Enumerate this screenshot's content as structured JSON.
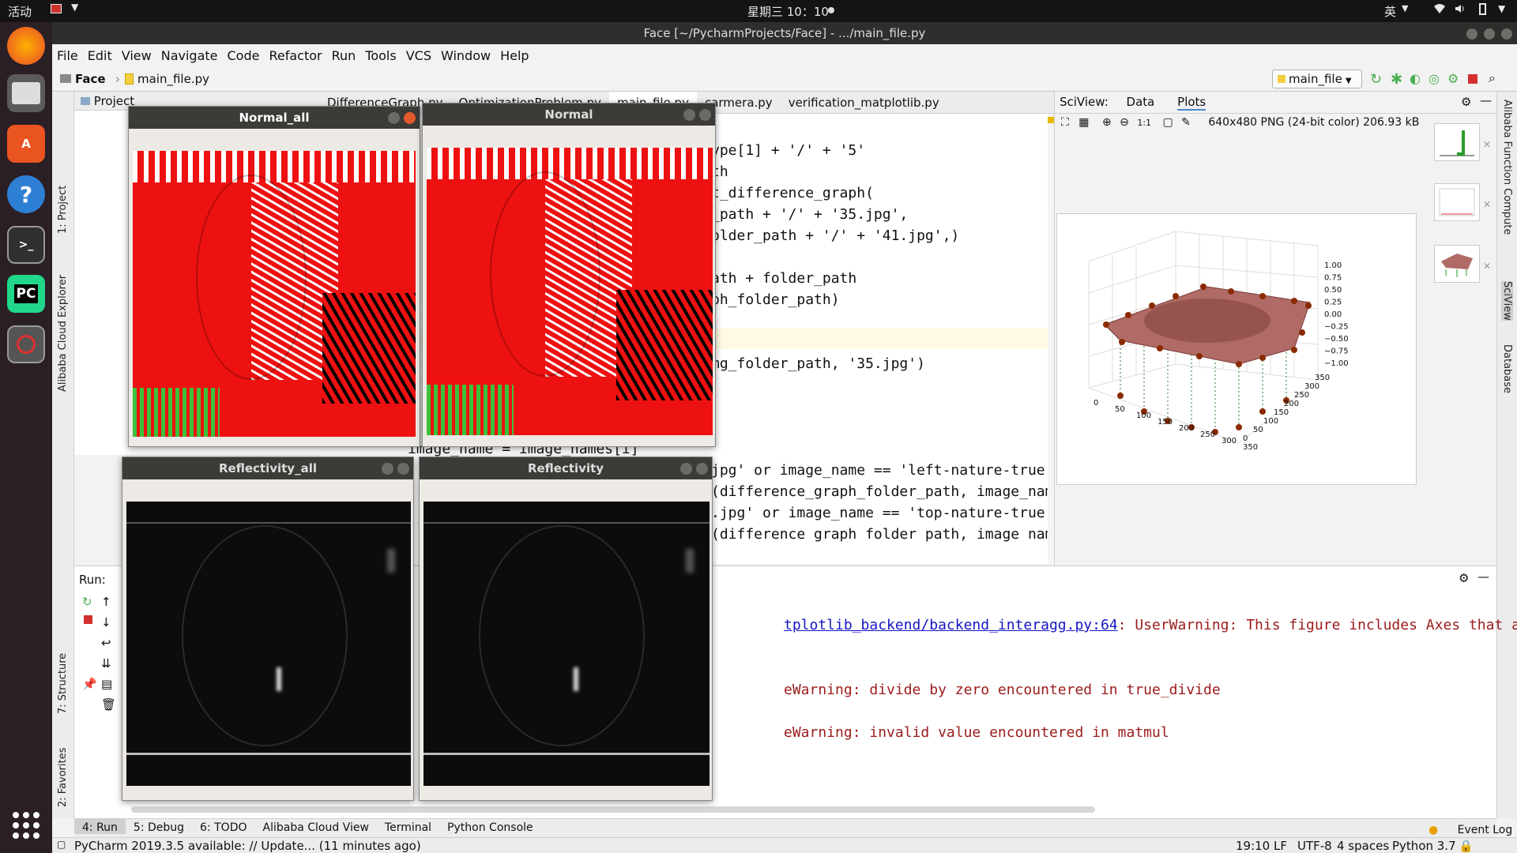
{
  "topbar": {
    "activities": "活动",
    "clock": "星期三 10：10",
    "ime": "英"
  },
  "window": {
    "title": "Face [~/PycharmProjects/Face] - .../main_file.py"
  },
  "menu": [
    "File",
    "Edit",
    "View",
    "Navigate",
    "Code",
    "Refactor",
    "Run",
    "Tools",
    "VCS",
    "Window",
    "Help"
  ],
  "nav": {
    "project": "Face",
    "file": "main_file.py",
    "run_config": "main_file"
  },
  "project_panel": {
    "title": "Project"
  },
  "left_tools": [
    "1: Project",
    "Alibaba Cloud Explorer",
    "7: Structure",
    "2: Favorites"
  ],
  "right_tools": [
    "Alibaba Function Compute",
    "SciView",
    "Database"
  ],
  "tabs": [
    "DifferenceGraph.py",
    "OptimizationProblem.py",
    "main_file.py",
    "carmera.py",
    "verification_matplotlib.py"
  ],
  "code": {
    "l1": "ype[1] + '/' + '5'",
    "l2": "th",
    "l3": "t_difference_graph(",
    "l4": "_path + '/' + '35.jpg',",
    "l5": "older_path + '/' + '41.jpg',)",
    "l6": "ath + folder_path",
    "l7": "ph_folder_path)",
    "l8": "mg_folder_path, '35.jpg')",
    "l9": "image_name = image_names[i]",
    "l10": "jpg' or image_name == 'left-nature-true",
    "l11": "(difference_graph_folder_path, image_nam",
    "l12": ".jpg' or image_name == 'top-nature-true",
    "l13": "(difference graph folder path, image nam"
  },
  "sciview": {
    "title": "SciView:",
    "tab_data": "Data",
    "tab_plots": "Plots",
    "info": "640x480 PNG (24-bit color) 206.93 kB",
    "zoom_label": "1:1"
  },
  "plot": {
    "z_ticks": [
      "1.00",
      "0.75",
      "0.50",
      "0.25",
      "0.00",
      "−0.25",
      "−0.50",
      "−0.75",
      "−1.00"
    ],
    "x_ticks": [
      "0",
      "50",
      "100",
      "150",
      "200",
      "250",
      "300",
      "350"
    ],
    "y_ticks": [
      "350",
      "300",
      "250",
      "200",
      "150",
      "100",
      "50",
      "0"
    ]
  },
  "run": {
    "label": "Run:",
    "line1_link": "tplotlib_backend/backend_interagg.py:64",
    "line1_rest": ": UserWarning: This figure includes Axes that are no",
    "line2": "eWarning: divide by zero encountered in true_divide",
    "line3": "eWarning: invalid value encountered in matmul"
  },
  "toolwindows": [
    "4: Run",
    "5: Debug",
    "6: TODO",
    "Alibaba Cloud View",
    "Terminal",
    "Python Console",
    "Event Log"
  ],
  "status": {
    "update": "PyCharm 2019.3.5 available: // Update... (11 minutes ago)",
    "position": "19:10",
    "line_sep": "LF",
    "encoding": "UTF-8",
    "indent": "4 spaces",
    "interpreter": "Python 3.7"
  },
  "cv_windows": {
    "w1": "Normal_all",
    "w2": "Normal",
    "w3": "Reflectivity_all",
    "w4": "Reflectivity"
  },
  "colors": {
    "accent": "#4a88c7",
    "error_text": "#9b1b1b",
    "red_map": "#ee1111"
  }
}
